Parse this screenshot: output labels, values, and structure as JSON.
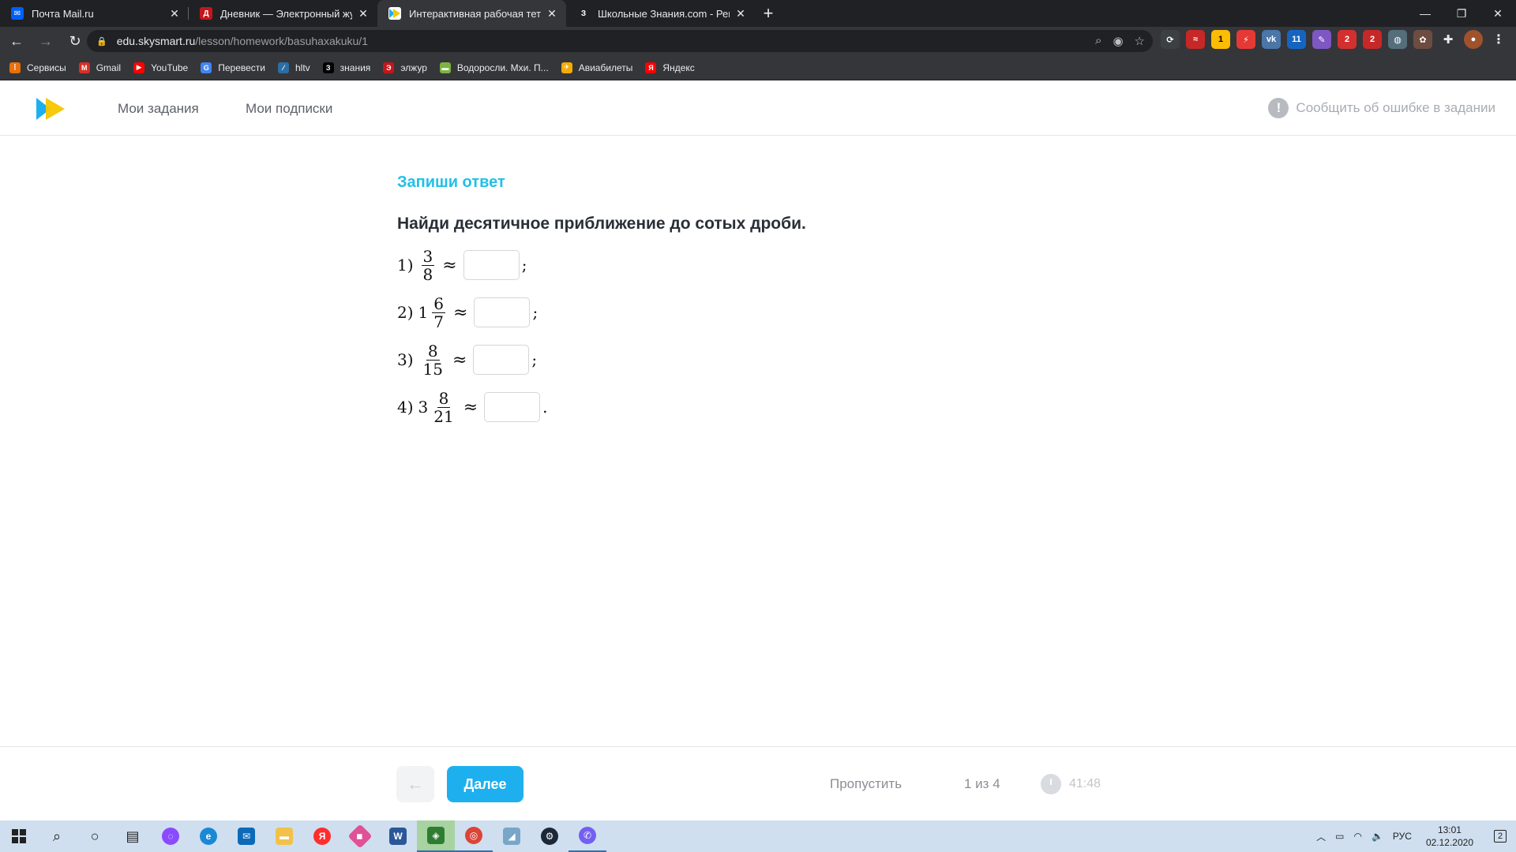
{
  "browser": {
    "tabs": [
      {
        "title": "Почта Mail.ru",
        "icon": "mail-icon",
        "color": "#005ff9",
        "active": false
      },
      {
        "title": "Дневник — Электронный журн",
        "icon": "diary-icon",
        "color": "#c4161c",
        "active": false
      },
      {
        "title": "Интерактивная рабочая тетрад",
        "icon": "skysmart-icon",
        "color": "#ffffff",
        "active": true
      },
      {
        "title": "Школьные Знания.com - Решае",
        "icon": "znanija-icon",
        "color": "#202124",
        "active": false
      }
    ],
    "url_host": "edu.skysmart.ru",
    "url_path": "/lesson/homework/basuhaxakuku/1",
    "bookmarks": [
      {
        "label": "Сервисы",
        "icon": "apps-grid-icon",
        "color": "#e8710a"
      },
      {
        "label": "Gmail",
        "icon": "gmail-icon",
        "color": "#d93025"
      },
      {
        "label": "YouTube",
        "icon": "youtube-icon",
        "color": "#ff0000"
      },
      {
        "label": "Перевести",
        "icon": "translate-icon",
        "color": "#4285f4"
      },
      {
        "label": "hltv",
        "icon": "hltv-icon",
        "color": "#2d6da3"
      },
      {
        "label": "знания",
        "icon": "znanija-icon",
        "color": "#000000"
      },
      {
        "label": "элжур",
        "icon": "eljur-icon",
        "color": "#c4161c"
      },
      {
        "label": "Водоросли. Мхи. П...",
        "icon": "folder-icon",
        "color": "#7cb342"
      },
      {
        "label": "Авиабилеты",
        "icon": "plane-icon",
        "color": "#f9ab00"
      },
      {
        "label": "Яндекс",
        "icon": "yandex-icon",
        "color": "#ff0000"
      }
    ],
    "extension_badges": [
      "1",
      "11",
      "2",
      "2"
    ]
  },
  "header": {
    "nav_tasks": "Мои задания",
    "nav_subscriptions": "Мои подписки",
    "report_error": "Сообщить об ошибке в задании"
  },
  "task": {
    "type_label": "Запиши ответ",
    "question": "Найди десятичное приближение до сотых дроби.",
    "items": [
      {
        "index": "1)",
        "whole": "",
        "numerator": "3",
        "denominator": "8",
        "end": ";"
      },
      {
        "index": "2)",
        "whole": "1",
        "numerator": "6",
        "denominator": "7",
        "end": ";"
      },
      {
        "index": "3)",
        "whole": "",
        "numerator": "8",
        "denominator": "15",
        "end": ";"
      },
      {
        "index": "4)",
        "whole": "3",
        "numerator": "8",
        "denominator": "21",
        "end": "."
      }
    ],
    "approx_symbol": "≈"
  },
  "footer": {
    "prev_arrow": "←",
    "next_label": "Далее",
    "skip_label": "Пропустить",
    "counter": "1 из 4",
    "timer": "41:48"
  },
  "taskbar": {
    "language": "РУС",
    "time": "13:01",
    "date": "02.12.2020",
    "notifications": "2"
  }
}
